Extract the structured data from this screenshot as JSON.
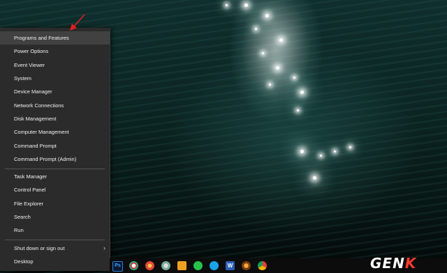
{
  "menu": {
    "items_group1": [
      {
        "label": "Programs and Features"
      },
      {
        "label": "Power Options"
      },
      {
        "label": "Event Viewer"
      },
      {
        "label": "System"
      },
      {
        "label": "Device Manager"
      },
      {
        "label": "Network Connections"
      },
      {
        "label": "Disk Management"
      },
      {
        "label": "Computer Management"
      },
      {
        "label": "Command Prompt"
      },
      {
        "label": "Command Prompt (Admin)"
      }
    ],
    "items_group2": [
      {
        "label": "Task Manager"
      },
      {
        "label": "Control Panel"
      },
      {
        "label": "File Explorer"
      },
      {
        "label": "Search"
      },
      {
        "label": "Run"
      }
    ],
    "items_group3": [
      {
        "label": "Shut down or sign out",
        "submenu_indicator": "›"
      },
      {
        "label": "Desktop"
      }
    ]
  },
  "taskbar": {
    "icons": [
      "photoshop-icon",
      "chrome-app-icon",
      "media-icon",
      "recycle-icon",
      "player-icon",
      "whatsapp-icon",
      "messenger-icon",
      "word-icon",
      "music-icon",
      "chrome-icon"
    ],
    "ps_label": "Ps",
    "word_label": "W"
  },
  "watermark": {
    "part1": "GEN",
    "part2": "K"
  },
  "colors": {
    "menu_bg": "#2b2b2b",
    "menu_highlight": "#414141",
    "arrow": "#e02020",
    "accent_k": "#ff3b2f"
  }
}
